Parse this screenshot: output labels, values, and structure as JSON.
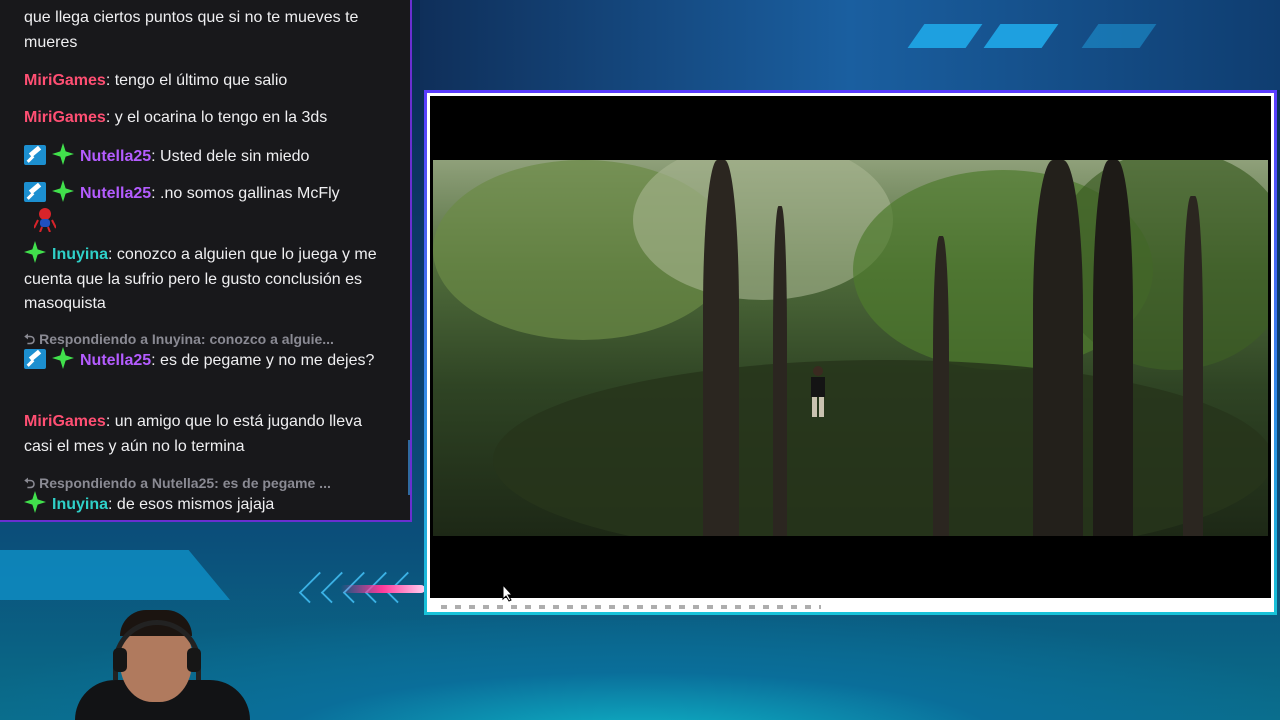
{
  "chat": {
    "messages": [
      {
        "user": "",
        "text": "que llega ciertos puntos que si no te mueves te mueres"
      },
      {
        "user": "MiriGames",
        "sep": ":",
        "text": " tengo el último que salio"
      },
      {
        "user": "MiriGames",
        "sep": ":",
        "text": " y el ocarina lo tengo en la 3ds"
      },
      {
        "user": "Nutella25",
        "sep": ":",
        "text": " Usted dele sin miedo"
      },
      {
        "user": "Nutella25",
        "sep": ":",
        "text": " .no somos gallinas McFly"
      },
      {
        "user": "Inuyina",
        "sep": ":",
        "text": " conozco a alguien que lo juega y me cuenta que la sufrio pero le gusto conclusión es masoquista"
      },
      {
        "user": "Nutella25",
        "sep": ":",
        "text": " es de pegame y no me dejes?"
      },
      {
        "user": "MiriGames",
        "sep": ":",
        "text": " un amigo que lo está jugando lleva casi el mes y aún no lo termina"
      },
      {
        "user": "Inuyina",
        "sep": ":",
        "text": " de esos mismos jajaja"
      }
    ],
    "replies": [
      "⮌ Respondiendo a Inuyina: conozco a alguie...",
      "⮌ Respondiendo a Nutella25: es de pegame ..."
    ]
  },
  "colors": {
    "MiriGames": "#ff4f73",
    "Nutella25": "#b45cff",
    "Inuyina": "#2fd0c8",
    "chat_bg": "#18181b",
    "border_accent": "#6a2fd0"
  },
  "icons": [
    "hammer-badge-icon",
    "star-badge-icon",
    "spider-emote-icon",
    "cursor-icon"
  ]
}
